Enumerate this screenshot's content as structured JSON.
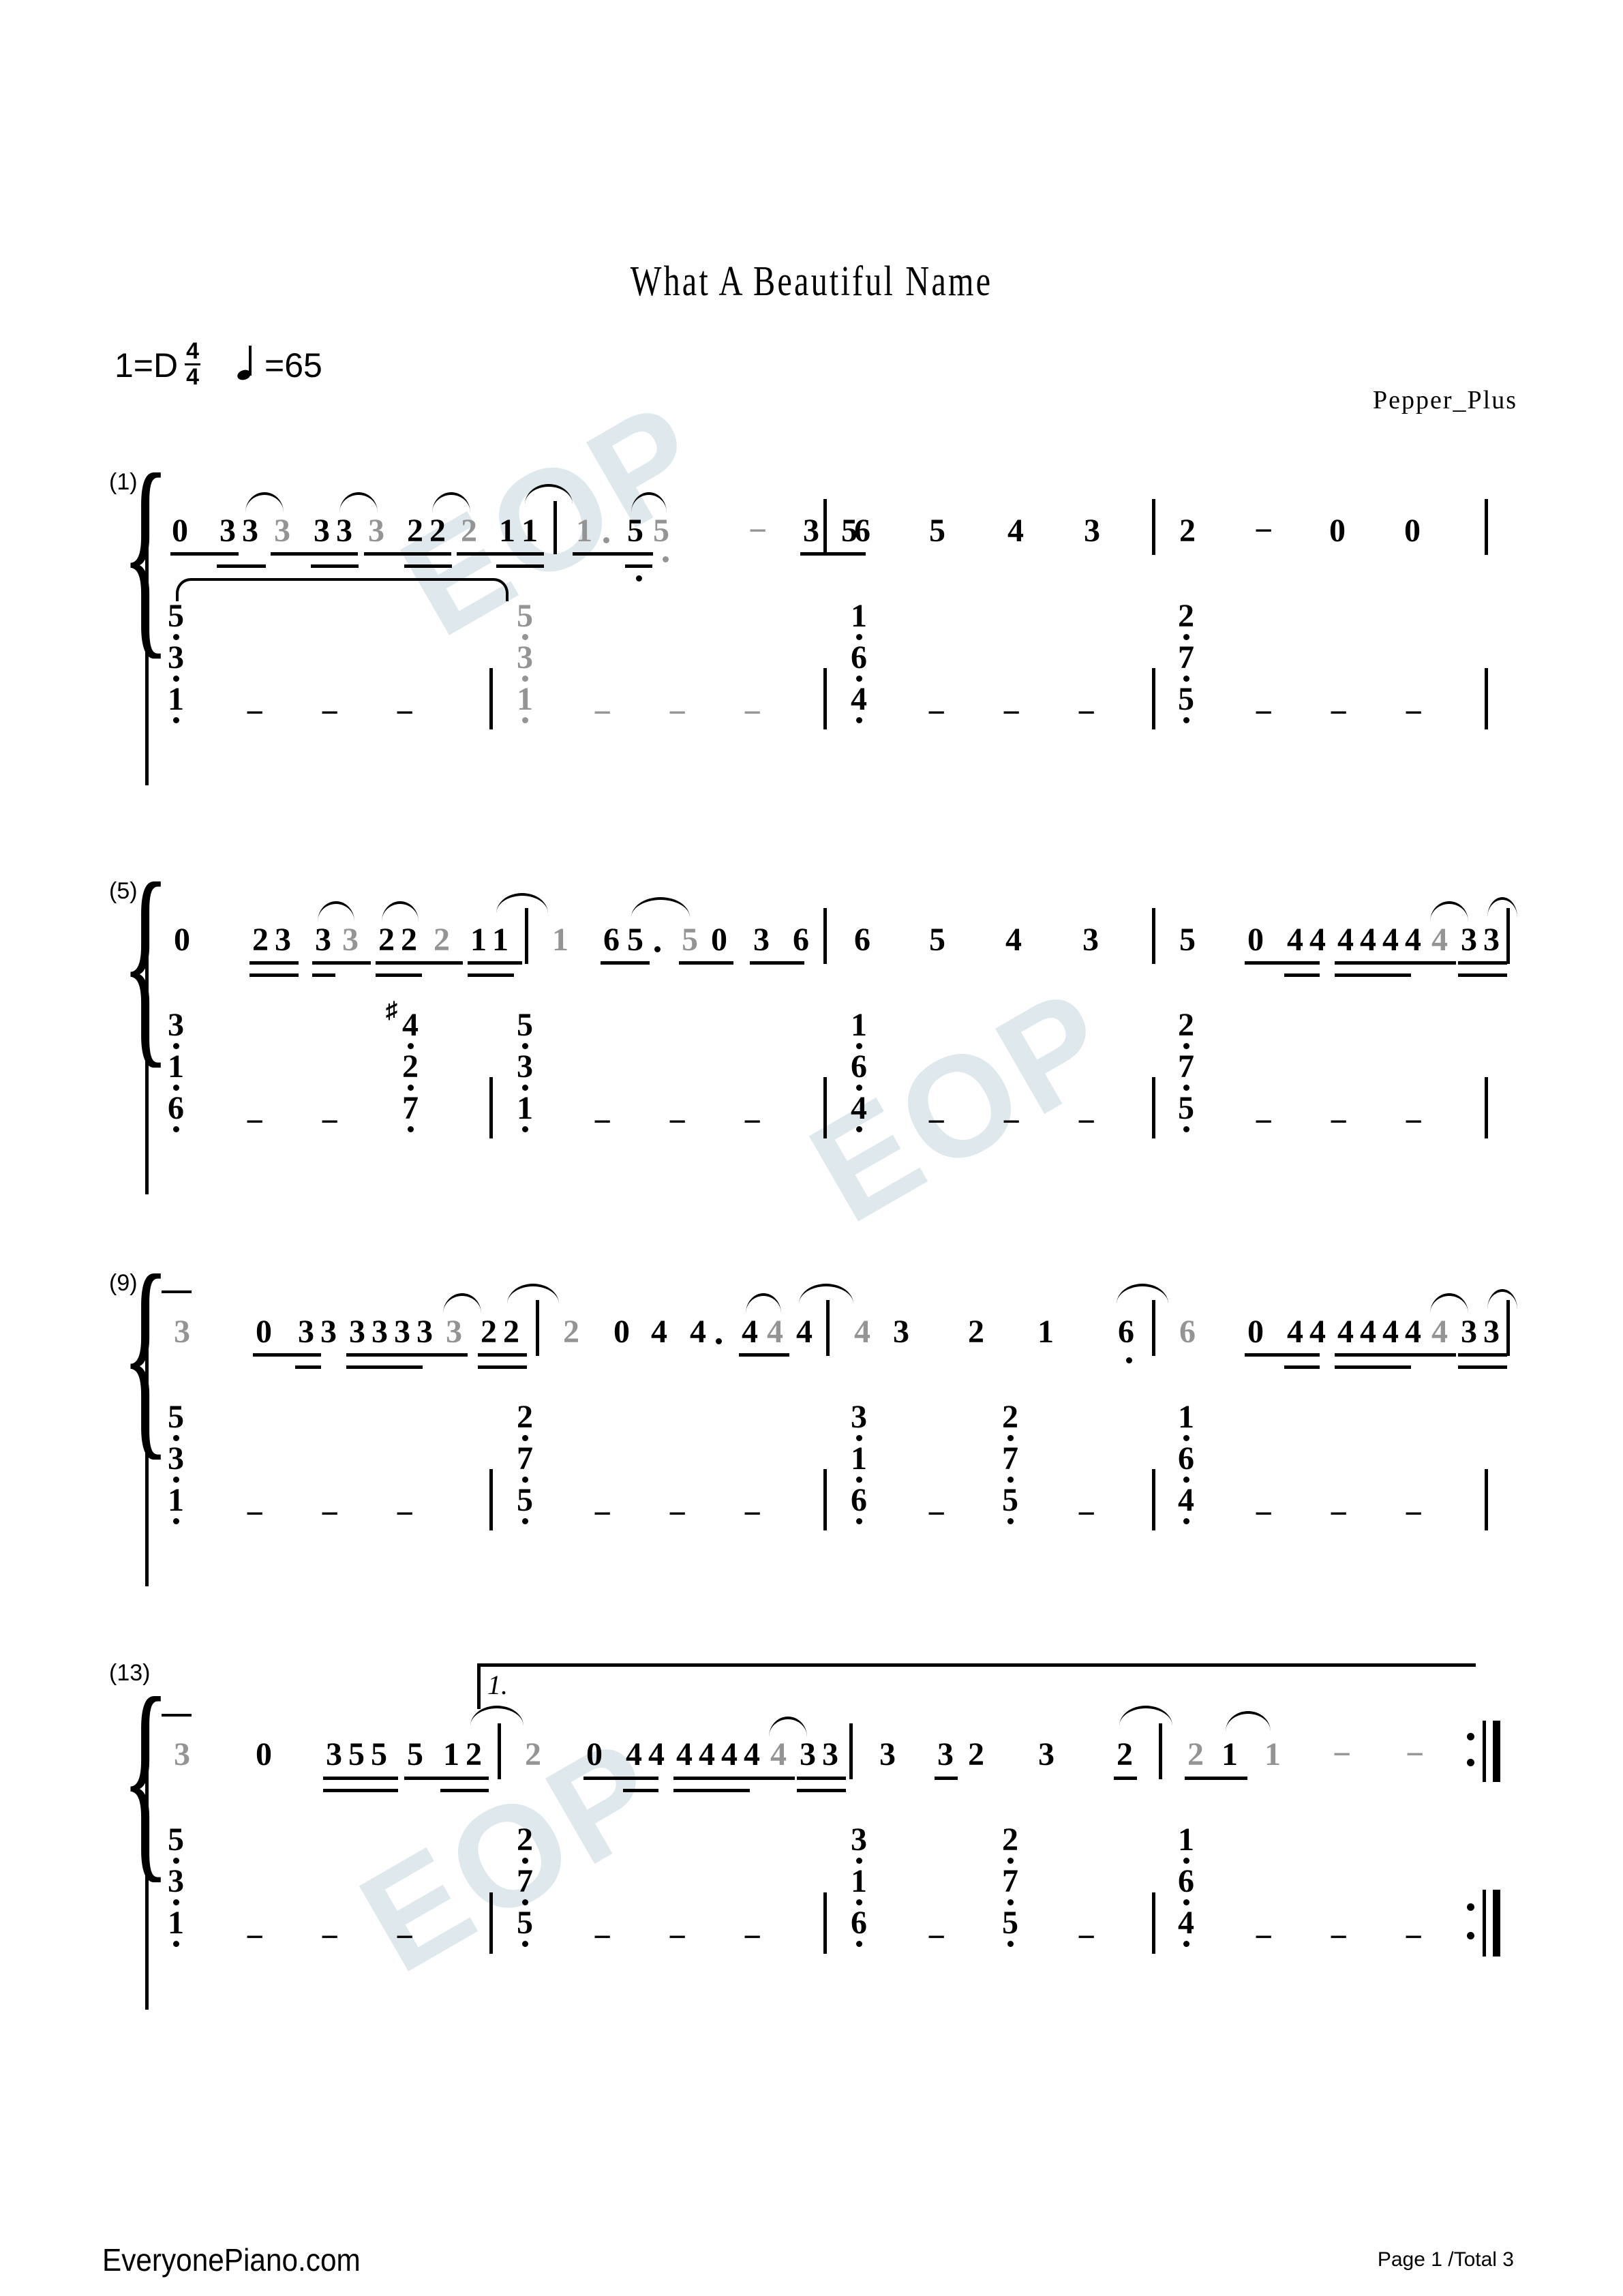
{
  "document": {
    "title": "What A Beautiful Name",
    "key_signature": "1=D",
    "time_signature": {
      "numerator": "4",
      "denominator": "4"
    },
    "tempo_label": "=65",
    "composer": "Pepper_Plus",
    "watermark": "EOP",
    "notation_type": "jianpu-numbered-musical-notation"
  },
  "footer": {
    "site": "EveryonePiano.com",
    "page_info": "Page 1 /Total 3"
  },
  "systems": [
    {
      "number": "(1)",
      "melody_text": "0 33 3 33 3 22 2 11 | 1· 5 5 − 3 5 | 6 5 4 3 | 2 − 0 0 |",
      "bass_text": "5/3/1 − − − | 5/3/1 − − − | 1/6/4 − − − | 2/7/5 − − −",
      "melody": [
        {
          "v": "0",
          "grey": false
        },
        {
          "v": "3",
          "grey": false
        },
        {
          "v": "3",
          "grey": false
        },
        {
          "v": "3",
          "grey": true
        },
        {
          "v": "3",
          "grey": false
        },
        {
          "v": "3",
          "grey": false
        },
        {
          "v": "3",
          "grey": true
        },
        {
          "v": "2",
          "grey": false
        },
        {
          "v": "2",
          "grey": false
        },
        {
          "v": "2",
          "grey": true
        },
        {
          "v": "1",
          "grey": false
        },
        {
          "v": "1",
          "grey": false
        },
        {
          "v": "1",
          "grey": true
        },
        {
          "v": "5",
          "grey": false
        },
        {
          "v": "5",
          "grey": true
        },
        {
          "v": "−",
          "grey": true
        },
        {
          "v": "3",
          "grey": false
        },
        {
          "v": "5",
          "grey": false
        },
        {
          "v": "6",
          "grey": false
        },
        {
          "v": "5",
          "grey": false
        },
        {
          "v": "4",
          "grey": false
        },
        {
          "v": "3",
          "grey": false
        },
        {
          "v": "2",
          "grey": false
        },
        {
          "v": "−",
          "grey": false
        },
        {
          "v": "0",
          "grey": false
        },
        {
          "v": "0",
          "grey": false
        }
      ],
      "chords": [
        {
          "notes": [
            "5",
            "3",
            "1"
          ],
          "grey": false,
          "dots": [
            true,
            true,
            true
          ]
        },
        {
          "notes": [
            "5",
            "3",
            "1"
          ],
          "grey": true,
          "dots": [
            true,
            true,
            true
          ]
        },
        {
          "notes": [
            "1",
            "6",
            "4"
          ],
          "grey": false,
          "dots": [
            true,
            true,
            true
          ]
        },
        {
          "notes": [
            "2",
            "7",
            "5"
          ],
          "grey": false,
          "dots": [
            true,
            true,
            true
          ]
        }
      ]
    },
    {
      "number": "(5)",
      "melody_text": "0 23 3 3 22 2 11 | 1 65· 5 0 3 6 | 6 5 4 3 | 5 0 44 4444 4 33 |",
      "bass_text": "3/1/6 − − ♯4/2/7 | 5/3/1 − − − | 1/6/4 − − − | 2/7/5 − − −",
      "melody": [
        {
          "v": "0",
          "grey": false
        },
        {
          "v": "2",
          "grey": false
        },
        {
          "v": "3",
          "grey": false
        },
        {
          "v": "3",
          "grey": false
        },
        {
          "v": "3",
          "grey": true
        },
        {
          "v": "2",
          "grey": false
        },
        {
          "v": "2",
          "grey": false
        },
        {
          "v": "2",
          "grey": true
        },
        {
          "v": "1",
          "grey": false
        },
        {
          "v": "1",
          "grey": false
        },
        {
          "v": "1",
          "grey": true
        },
        {
          "v": "6",
          "grey": false
        },
        {
          "v": "5",
          "grey": false
        },
        {
          "v": "5",
          "grey": true
        },
        {
          "v": "0",
          "grey": false
        },
        {
          "v": "3",
          "grey": false
        },
        {
          "v": "6",
          "grey": false
        },
        {
          "v": "6",
          "grey": false
        },
        {
          "v": "5",
          "grey": false
        },
        {
          "v": "4",
          "grey": false
        },
        {
          "v": "3",
          "grey": false
        },
        {
          "v": "5",
          "grey": false
        },
        {
          "v": "0",
          "grey": false
        },
        {
          "v": "4",
          "grey": false
        },
        {
          "v": "4",
          "grey": false
        },
        {
          "v": "4",
          "grey": false
        },
        {
          "v": "4",
          "grey": false
        },
        {
          "v": "4",
          "grey": false
        },
        {
          "v": "4",
          "grey": false
        },
        {
          "v": "4",
          "grey": true
        },
        {
          "v": "3",
          "grey": false
        },
        {
          "v": "3",
          "grey": false
        }
      ],
      "chords": [
        {
          "notes": [
            "3",
            "1",
            "6"
          ],
          "grey": false,
          "dots": [
            true,
            true,
            true
          ]
        },
        {
          "notes": [
            "4",
            "2",
            "7"
          ],
          "grey": false,
          "dots": [
            true,
            true,
            false
          ],
          "accidental": "♯"
        },
        {
          "notes": [
            "5",
            "3",
            "1"
          ],
          "grey": false,
          "dots": [
            true,
            true,
            true
          ]
        },
        {
          "notes": [
            "1",
            "6",
            "4"
          ],
          "grey": false,
          "dots": [
            true,
            true,
            true
          ]
        },
        {
          "notes": [
            "2",
            "7",
            "5"
          ],
          "grey": false,
          "dots": [
            true,
            true,
            true
          ]
        }
      ]
    },
    {
      "number": "(9)",
      "melody_text": "3 0 33 3333 3 22 | 2 0 4 4· 4 4 4 | 4 3 2 1 6 | 6 0 44 4444 4 33 |",
      "bass_text": "5/3/1 − − − | 2/7/5 − − − | 3/1/6 − 2/7/5 − | 1/6/4 − − −",
      "melody": [
        {
          "v": "3",
          "grey": true
        },
        {
          "v": "0",
          "grey": false
        },
        {
          "v": "3",
          "grey": false
        },
        {
          "v": "3",
          "grey": false
        },
        {
          "v": "3",
          "grey": false
        },
        {
          "v": "3",
          "grey": false
        },
        {
          "v": "3",
          "grey": false
        },
        {
          "v": "3",
          "grey": false
        },
        {
          "v": "3",
          "grey": true
        },
        {
          "v": "2",
          "grey": false
        },
        {
          "v": "2",
          "grey": false
        },
        {
          "v": "2",
          "grey": true
        },
        {
          "v": "0",
          "grey": false
        },
        {
          "v": "4",
          "grey": false
        },
        {
          "v": "4",
          "grey": false
        },
        {
          "v": "4",
          "grey": false
        },
        {
          "v": "4",
          "grey": true
        },
        {
          "v": "4",
          "grey": false
        },
        {
          "v": "4",
          "grey": true
        },
        {
          "v": "3",
          "grey": false
        },
        {
          "v": "2",
          "grey": false
        },
        {
          "v": "1",
          "grey": false
        },
        {
          "v": "6",
          "grey": false
        },
        {
          "v": "6",
          "grey": true
        },
        {
          "v": "0",
          "grey": false
        },
        {
          "v": "4",
          "grey": false
        },
        {
          "v": "4",
          "grey": false
        },
        {
          "v": "4",
          "grey": false
        },
        {
          "v": "4",
          "grey": false
        },
        {
          "v": "4",
          "grey": false
        },
        {
          "v": "4",
          "grey": false
        },
        {
          "v": "4",
          "grey": true
        },
        {
          "v": "3",
          "grey": false
        },
        {
          "v": "3",
          "grey": false
        }
      ],
      "chords": [
        {
          "notes": [
            "5",
            "3",
            "1"
          ],
          "grey": false,
          "dots": [
            true,
            true,
            true
          ]
        },
        {
          "notes": [
            "2",
            "7",
            "5"
          ],
          "grey": false,
          "dots": [
            true,
            true,
            true
          ]
        },
        {
          "notes": [
            "3",
            "1",
            "6"
          ],
          "grey": false,
          "dots": [
            true,
            true,
            true
          ]
        },
        {
          "notes": [
            "2",
            "7",
            "5"
          ],
          "grey": false,
          "dots": [
            true,
            true,
            true
          ]
        },
        {
          "notes": [
            "1",
            "6",
            "4"
          ],
          "grey": false,
          "dots": [
            true,
            true,
            true
          ]
        }
      ]
    },
    {
      "number": "(13)",
      "ending_label": "1.",
      "melody_text": "3 0 355 5 12 | 2 0 44 4444 4 33 | 3 3 2 3 2 | 2 1 1 − − :||",
      "bass_text": "5/3/1 − − − | 2/7/5 − − − | 3/1/6 − 2/7/5 − | 1/6/4 − − − :||",
      "melody": [
        {
          "v": "3",
          "grey": true
        },
        {
          "v": "0",
          "grey": false
        },
        {
          "v": "3",
          "grey": false
        },
        {
          "v": "5",
          "grey": false
        },
        {
          "v": "5",
          "grey": false
        },
        {
          "v": "5",
          "grey": false
        },
        {
          "v": "1",
          "grey": false
        },
        {
          "v": "2",
          "grey": false
        },
        {
          "v": "2",
          "grey": true
        },
        {
          "v": "0",
          "grey": false
        },
        {
          "v": "4",
          "grey": false
        },
        {
          "v": "4",
          "grey": false
        },
        {
          "v": "4",
          "grey": false
        },
        {
          "v": "4",
          "grey": false
        },
        {
          "v": "4",
          "grey": false
        },
        {
          "v": "4",
          "grey": false
        },
        {
          "v": "4",
          "grey": true
        },
        {
          "v": "3",
          "grey": false
        },
        {
          "v": "3",
          "grey": false
        },
        {
          "v": "3",
          "grey": false
        },
        {
          "v": "3",
          "grey": false
        },
        {
          "v": "2",
          "grey": false
        },
        {
          "v": "3",
          "grey": false
        },
        {
          "v": "2",
          "grey": false
        },
        {
          "v": "2",
          "grey": true
        },
        {
          "v": "1",
          "grey": false
        },
        {
          "v": "1",
          "grey": true
        },
        {
          "v": "−",
          "grey": true
        },
        {
          "v": "−",
          "grey": true
        }
      ],
      "chords": [
        {
          "notes": [
            "5",
            "3",
            "1"
          ],
          "grey": false,
          "dots": [
            true,
            true,
            true
          ]
        },
        {
          "notes": [
            "2",
            "7",
            "5"
          ],
          "grey": false,
          "dots": [
            true,
            true,
            true
          ]
        },
        {
          "notes": [
            "3",
            "1",
            "6"
          ],
          "grey": false,
          "dots": [
            true,
            true,
            true
          ]
        },
        {
          "notes": [
            "2",
            "7",
            "5"
          ],
          "grey": false,
          "dots": [
            true,
            true,
            true
          ]
        },
        {
          "notes": [
            "1",
            "6",
            "4"
          ],
          "grey": false,
          "dots": [
            true,
            true,
            true
          ]
        }
      ]
    }
  ]
}
